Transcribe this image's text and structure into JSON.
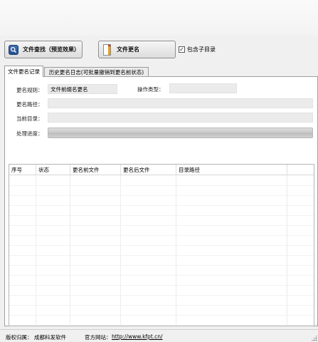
{
  "toolbar": {
    "find_label": "文件查找（预览效果）",
    "rename_label": "文件更名",
    "include_subdirs_label": "包含子目录",
    "include_subdirs_checked": true
  },
  "tabs": [
    {
      "label": "文件更名记录",
      "active": true
    },
    {
      "label": "历史更名日志(可批量撤销到更名前状态)",
      "active": false
    }
  ],
  "form": {
    "rule_label": "更名规则：",
    "rule_value": "文件前缀名更名",
    "op_type_label": "操作类型：",
    "op_type_value": "",
    "path_label": "更名路径：",
    "path_value": "",
    "current_dir_label": "当前目录：",
    "current_dir_value": "",
    "progress_label": "处理进度：",
    "progress": 0
  },
  "table": {
    "columns": [
      "序号",
      "状态",
      "更名前文件",
      "更名后文件",
      "目录路径"
    ],
    "rows": []
  },
  "status_bar": {
    "copyright_label": "版权归属：",
    "copyright_value": "成都科发软件",
    "website_label": "官方网站：",
    "website_url": "http://www.kfpt.cn/"
  },
  "icons": {
    "find": "search-icon",
    "rename": "file-rename-icon"
  },
  "colors": {
    "search_icon": "#2a5a9e",
    "rename_icon_accent": "#e8a020"
  }
}
